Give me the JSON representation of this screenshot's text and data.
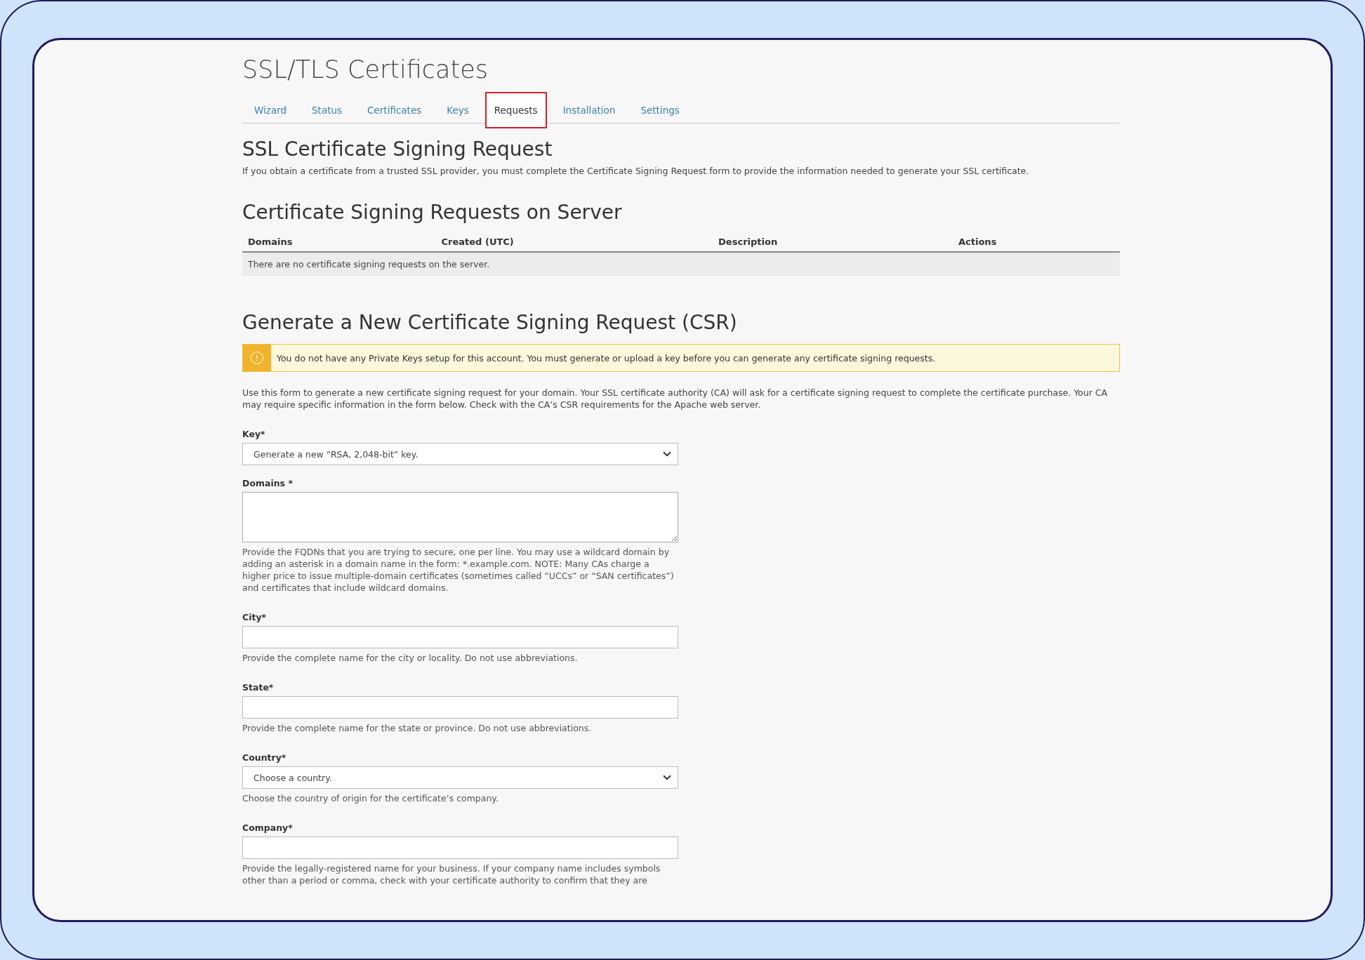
{
  "page_title": "SSL/TLS Certificates",
  "tabs": [
    {
      "label": "Wizard",
      "selected": false
    },
    {
      "label": "Status",
      "selected": false
    },
    {
      "label": "Certificates",
      "selected": false
    },
    {
      "label": "Keys",
      "selected": false
    },
    {
      "label": "Requests",
      "selected": true
    },
    {
      "label": "Installation",
      "selected": false
    },
    {
      "label": "Settings",
      "selected": false
    }
  ],
  "intro": {
    "heading": "SSL Certificate Signing Request",
    "text": "If you obtain a certificate from a trusted SSL provider, you must complete the Certificate Signing Request form to provide the information needed to generate your SSL certificate."
  },
  "server_requests": {
    "heading": "Certificate Signing Requests on Server",
    "columns": [
      "Domains",
      "Created (UTC)",
      "Description",
      "Actions"
    ],
    "empty_message": "There are no certificate signing requests on the server."
  },
  "generate": {
    "heading": "Generate a New Certificate Signing Request (CSR)",
    "alert": {
      "icon": "!",
      "text": "You do not have any Private Keys setup for this account. You must generate or upload a key before you can generate any certificate signing requests."
    },
    "description": "Use this form to generate a new certificate signing request for your domain. Your SSL certificate authority (CA) will ask for a certificate signing request to complete the certificate purchase. Your CA may require specific information in the form below. Check with the CA’s CSR requirements for the Apache web server.",
    "fields": [
      {
        "kind": "select",
        "label": "Key*",
        "value": "Generate a new “RSA, 2,048-bit” key."
      },
      {
        "kind": "textarea",
        "label": "Domains *",
        "help": "Provide the FQDNs that you are trying to secure, one per line. You may use a wildcard domain by adding an asterisk in a domain name in the form: *.example.com. NOTE: Many CAs charge a higher price to issue multiple-domain certificates (sometimes called “UCCs” or “SAN certificates”) and certificates that include wildcard domains."
      },
      {
        "kind": "text",
        "label": "City*",
        "help": "Provide the complete name for the city or locality. Do not use abbreviations."
      },
      {
        "kind": "text",
        "label": "State*",
        "help": "Provide the complete name for the state or province. Do not use abbreviations."
      },
      {
        "kind": "select",
        "label": "Country*",
        "value": "Choose a country.",
        "help": "Choose the country of origin for the certificate’s company."
      },
      {
        "kind": "text",
        "label": "Company*",
        "help": "Provide the legally-registered name for your business. If your company name includes symbols other than a period or comma, check with your certificate authority to confirm that they are"
      }
    ]
  }
}
